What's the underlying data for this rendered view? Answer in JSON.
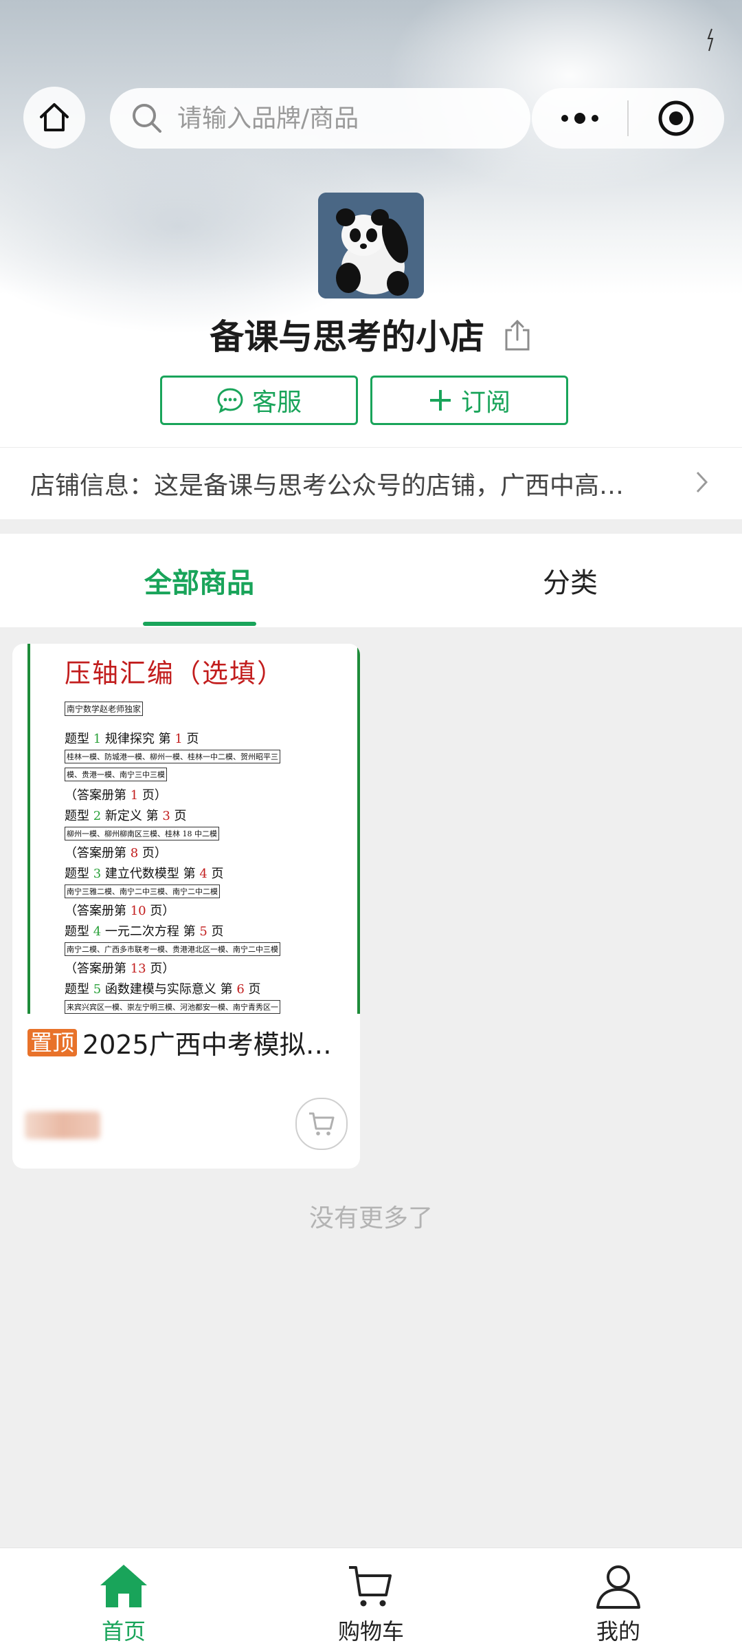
{
  "header": {
    "search_placeholder": "请输入品牌/商品"
  },
  "shop": {
    "name": "备课与思考的小店",
    "service_label": "客服",
    "subscribe_label": "订阅",
    "info_text": "店铺信息：这是备课与思考公众号的店铺，广西中高…"
  },
  "tabs": {
    "all_products": "全部商品",
    "category": "分类"
  },
  "product": {
    "badge": "置顶",
    "title": "2025广西中考模拟…",
    "cover": {
      "title": "压轴汇编（选填）",
      "author": "南宁数学赵老师独家",
      "sections": [
        {
          "prefix": "题型 ",
          "num": "1",
          "name": " 规律探究  第 ",
          "page": "1",
          "suffix": " 页",
          "src": "桂林一模、防城港一模、柳州一模、桂林一中二模、贺州昭平三",
          "src2": "模、贵港一模、南宁三中三模",
          "answer_pre": "（答案册第 ",
          "answer_page": "1",
          "answer_suf": " 页）"
        },
        {
          "prefix": "题型 ",
          "num": "2",
          "name": " 新定义  第 ",
          "page": "3",
          "suffix": " 页",
          "src": "柳州一模、柳州柳南区三模、桂林 18 中二模",
          "answer_pre": "（答案册第 ",
          "answer_page": "8",
          "answer_suf": " 页）"
        },
        {
          "prefix": "题型 ",
          "num": "3",
          "name": " 建立代数模型  第 ",
          "page": "4",
          "suffix": " 页",
          "src": "南宁三雅二模、南宁二中三模、南宁二中二模",
          "answer_pre": "（答案册第 ",
          "answer_page": "10",
          "answer_suf": " 页）"
        },
        {
          "prefix": "题型 ",
          "num": "4",
          "name": " 一元二次方程  第 ",
          "page": "5",
          "suffix": " 页",
          "src": "南宁二模、广西多市联考一模、贵港港北区一模、南宁二中三模",
          "answer_pre": "（答案册第 ",
          "answer_page": "13",
          "answer_suf": " 页）"
        },
        {
          "prefix": "题型 ",
          "num": "5",
          "name": " 函数建模与实际意义  第 ",
          "page": "6",
          "suffix": " 页",
          "src": "来宾兴宾区一模、崇左宁明三模、河池都安一模、南宁青秀区一"
        }
      ]
    }
  },
  "list_footer": "没有更多了",
  "tabbar": {
    "home": "首页",
    "cart": "购物车",
    "mine": "我的"
  },
  "colors": {
    "accent": "#19a45a",
    "pin_badge": "#e8722a"
  }
}
